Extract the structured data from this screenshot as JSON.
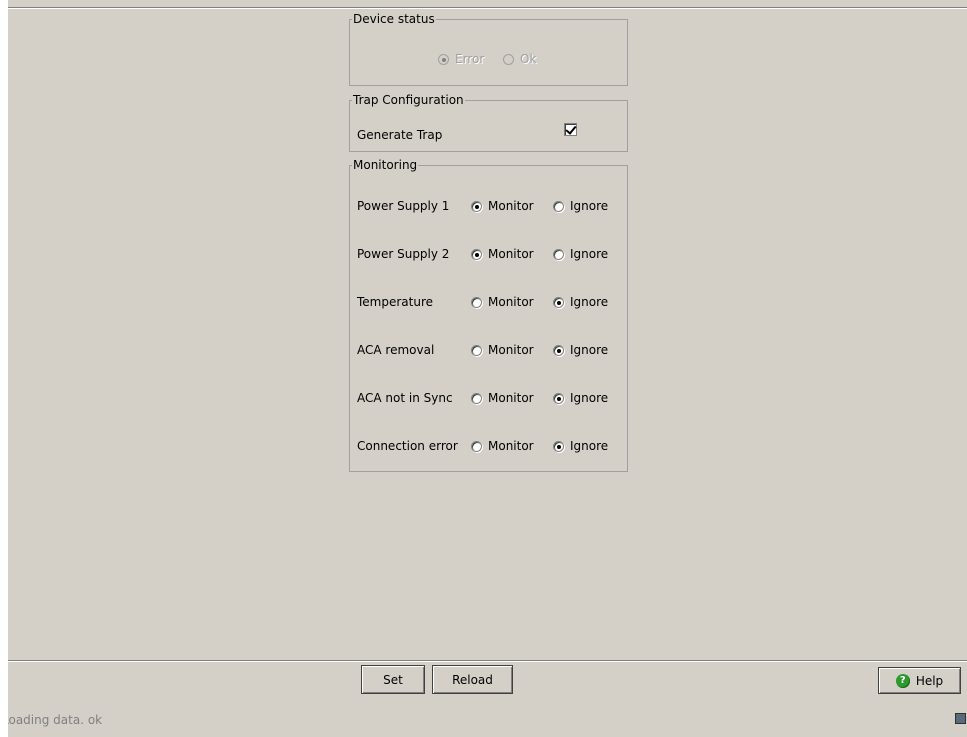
{
  "device_status": {
    "legend": "Device status",
    "options": [
      {
        "label": "Error",
        "selected": true
      },
      {
        "label": "Ok",
        "selected": false
      }
    ]
  },
  "trap_configuration": {
    "legend": "Trap Configuration",
    "generate_trap_label": "Generate Trap",
    "generate_trap_checked": true
  },
  "monitoring": {
    "legend": "Monitoring",
    "rows": [
      {
        "label": "Power Supply 1",
        "monitor": "Monitor",
        "ignore": "Ignore",
        "selected": "monitor"
      },
      {
        "label": "Power Supply 2",
        "monitor": "Monitor",
        "ignore": "Ignore",
        "selected": "monitor"
      },
      {
        "label": "Temperature",
        "monitor": "Monitor",
        "ignore": "Ignore",
        "selected": "ignore"
      },
      {
        "label": "ACA removal",
        "monitor": "Monitor",
        "ignore": "Ignore",
        "selected": "ignore"
      },
      {
        "label": "ACA not in Sync",
        "monitor": "Monitor",
        "ignore": "Ignore",
        "selected": "ignore"
      },
      {
        "label": "Connection error",
        "monitor": "Monitor",
        "ignore": "Ignore",
        "selected": "ignore"
      }
    ]
  },
  "buttons": {
    "set": "Set",
    "reload": "Reload",
    "help": "Help",
    "help_icon": "question-icon"
  },
  "status_bar": {
    "text": "Loading data. ok"
  }
}
